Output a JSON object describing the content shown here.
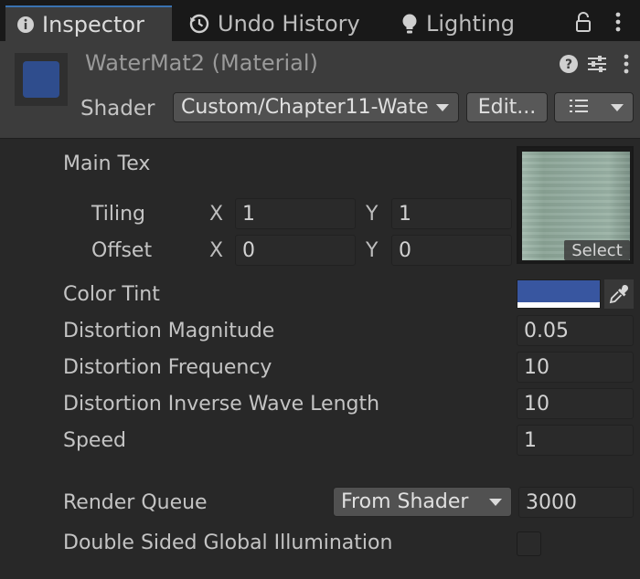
{
  "tabs": {
    "inspector": "Inspector",
    "undo_history": "Undo History",
    "lighting": "Lighting"
  },
  "header": {
    "material_title": "WaterMat2 (Material)",
    "shader_label": "Shader",
    "shader_value": "Custom/Chapter11-Wate",
    "edit_button": "Edit..."
  },
  "main_tex": {
    "label": "Main Tex",
    "tiling_label": "Tiling",
    "offset_label": "Offset",
    "x": "X",
    "y": "Y",
    "tiling_x": "1",
    "tiling_y": "1",
    "offset_x": "0",
    "offset_y": "0",
    "select_label": "Select"
  },
  "properties": {
    "color_tint_label": "Color Tint",
    "color_tint_value": "#3856a0",
    "distortion_magnitude_label": "Distortion Magnitude",
    "distortion_magnitude_value": "0.05",
    "distortion_frequency_label": "Distortion Frequency",
    "distortion_frequency_value": "10",
    "distortion_inverse_label": "Distortion Inverse Wave Length",
    "distortion_inverse_value": "10",
    "speed_label": "Speed",
    "speed_value": "1"
  },
  "render_queue": {
    "label": "Render Queue",
    "mode": "From Shader",
    "value": "3000"
  },
  "gi": {
    "label": "Double Sided Global Illumination",
    "checked": false
  },
  "colors": {
    "accent": "#3a72b0",
    "panel": "#282828",
    "header": "#3c3c3c"
  }
}
